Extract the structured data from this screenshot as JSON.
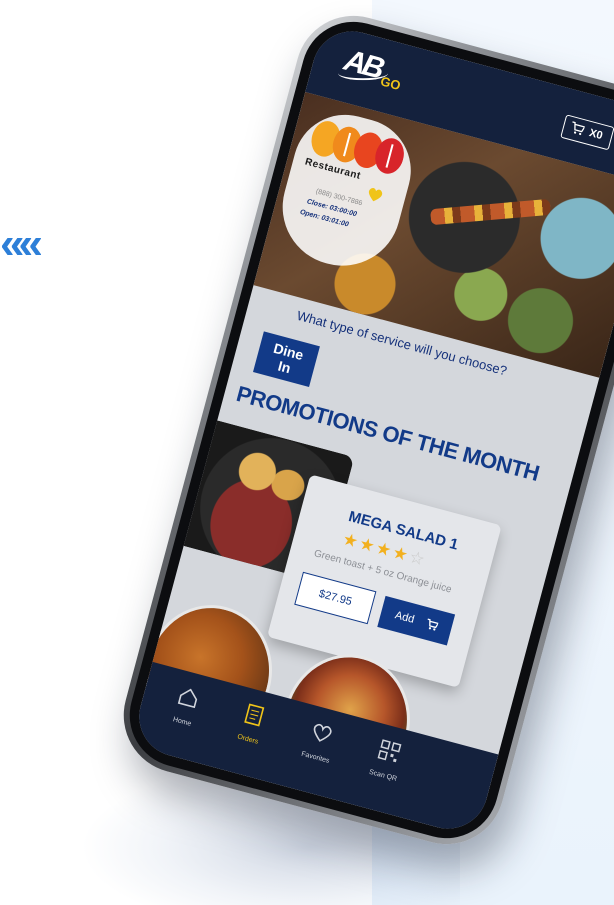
{
  "app": {
    "logo_text": "AB",
    "logo_suffix": "GO",
    "cart_count": "X0"
  },
  "restaurant": {
    "name": "Restaurant",
    "phone": "(888) 300-7886",
    "close": "Close: 03:00:00",
    "open": "Open: 03:01:00"
  },
  "service": {
    "question": "What type of service will you choose?",
    "dine_in_label": "Dine In"
  },
  "promotions": {
    "title": "PROMOTIONS OF THE MONTH",
    "item": {
      "name": "MEGA SALAD 1",
      "rating": 4,
      "rating_max": 5,
      "description": "Green toast + 5 oz Orange juice",
      "price": "$27.95",
      "add_label": "Add"
    }
  },
  "nav": {
    "items": [
      {
        "label": "Home",
        "icon": "home-icon"
      },
      {
        "label": "Orders",
        "icon": "orders-icon",
        "active": true
      },
      {
        "label": "Favorites",
        "icon": "heart-icon"
      },
      {
        "label": "Scan QR",
        "icon": "qr-icon"
      }
    ]
  },
  "colors": {
    "navy": "#14213d",
    "brand_blue": "#123a88",
    "accent_yellow": "#f0c419",
    "star": "#f2b01e",
    "page_chevrons": "#2d7fd8"
  },
  "decor": {
    "chevrons": "««"
  }
}
